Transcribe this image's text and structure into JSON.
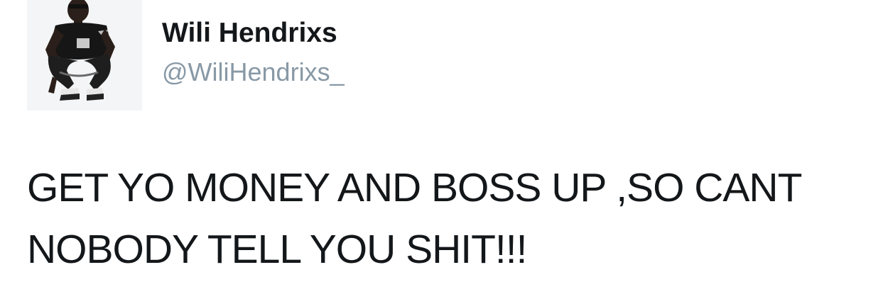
{
  "tweet": {
    "author": {
      "display_name": "Wili Hendrixs",
      "handle": "@WiliHendrixs_",
      "avatar_icon": "profile-photo-person-crouching"
    },
    "text": "GET YO MONEY AND BOSS UP ,SO CANT NOBODY TELL YOU SHIT!!!"
  },
  "colors": {
    "text_primary": "#14171a",
    "text_secondary": "#8899a6",
    "background": "#ffffff"
  }
}
